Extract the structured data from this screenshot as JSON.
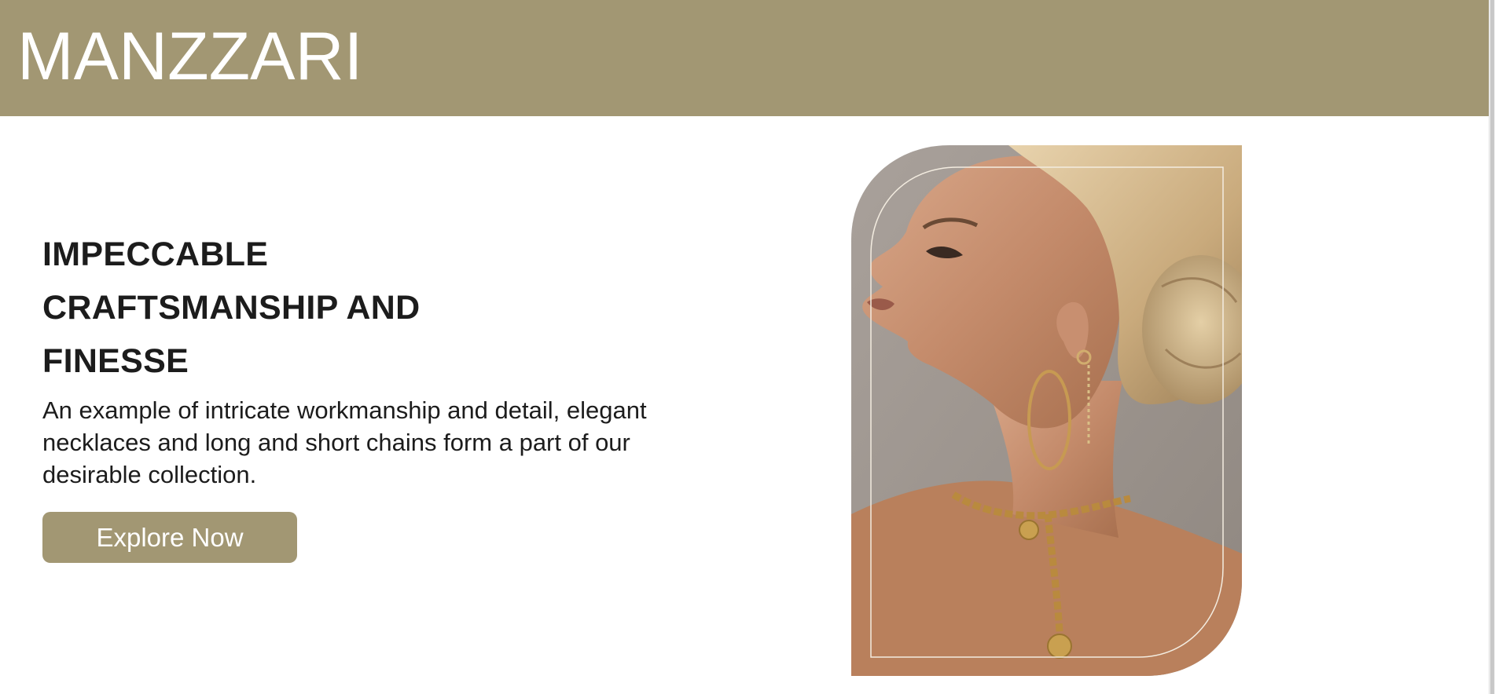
{
  "header": {
    "brand": "MANZZARI",
    "background_color": "#a29773"
  },
  "hero": {
    "headline_lines": [
      "IMPECCABLE",
      "CRAFTSMANSHIP AND",
      "FINESSE"
    ],
    "description": "An example of intricate workmanship and detail, elegant necklaces and long and short chains form a part of our desirable collection.",
    "cta_label": "Explore Now",
    "cta_color": "#a29773"
  },
  "image": {
    "subject": "model-profile-gold-jewelry-photo",
    "alt": "Model in profile wearing gold hoop earrings and a chunky gold chain necklace"
  }
}
